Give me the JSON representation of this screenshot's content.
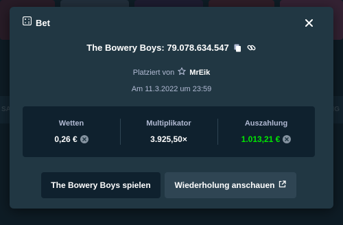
{
  "background": {
    "left_text": "SA",
    "right_text": "NG"
  },
  "modal": {
    "title": "Bet",
    "game_line": "The Bowery Boys: 79.078.634.547",
    "placed_by_label": "Platziert von",
    "username": "MrEik",
    "date": "Am 11.3.2022 um 23:59",
    "stats": {
      "wager_label": "Wetten",
      "wager_value": "0,26 €",
      "multiplier_label": "Multiplikator",
      "multiplier_value": "3.925,50×",
      "payout_label": "Auszahlung",
      "payout_value": "1.013,21 €"
    },
    "play_button": "The Bowery Boys spielen",
    "replay_button": "Wiederholung anschauen"
  },
  "colors": {
    "modal_bg": "#213743",
    "stats_bg": "#0f212e",
    "payout_green": "#00e701",
    "secondary_button": "#2f4553"
  },
  "icons": {
    "header": "bet-slip-icon",
    "close": "close-icon",
    "copy": "copy-icon",
    "link": "link-icon",
    "user": "star-icon",
    "currency": "currency-coin-icon",
    "external": "external-link-icon"
  }
}
